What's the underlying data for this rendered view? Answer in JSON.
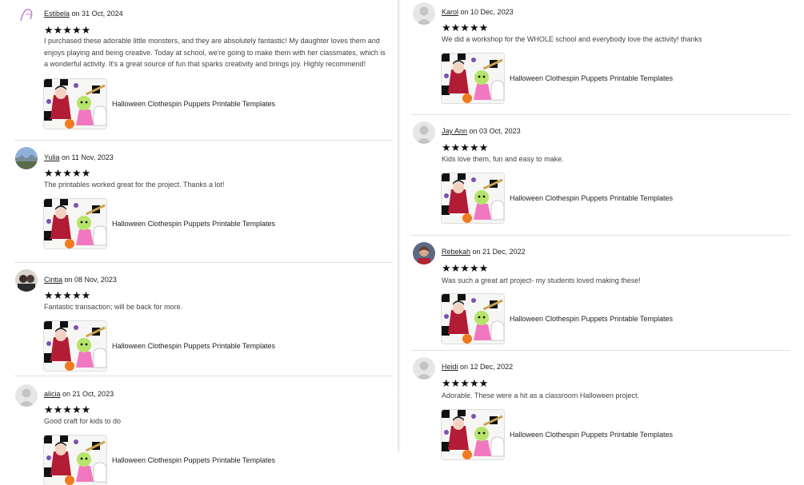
{
  "reviews_left": [
    {
      "name": "Estibela",
      "date_text": "on 31 Oct, 2024",
      "stars": "★★★★★",
      "text": "I purchased these adorable little monsters, and they are absolutely fantastic! My daughter loves them and enjoys playing and being creative. Today at school, we're going to make them with her classmates, which is a wonderful activity. It's a great source of fun that sparks creativity and brings joy. Highly recommend!",
      "item_title": "Halloween Clothespin Puppets Printable Templates"
    },
    {
      "name": "Yulia",
      "date_text": "on 11 Nov, 2023",
      "stars": "★★★★★",
      "text": "The printables worked great for the project. Thanks a lot!",
      "item_title": "Halloween Clothespin Puppets Printable Templates"
    },
    {
      "name": "Cintia",
      "date_text": "on 08 Nov, 2023",
      "stars": "★★★★★",
      "text": "Fantastic transaction; will be back for more.",
      "item_title": "Halloween Clothespin Puppets Printable Templates"
    },
    {
      "name": "alicia",
      "date_text": "on 21 Oct, 2023",
      "stars": "★★★★★",
      "text": "Good craft for kids to do",
      "item_title": "Halloween Clothespin Puppets Printable Templates"
    }
  ],
  "reviews_right": [
    {
      "name": "Karol",
      "date_text": "on 10 Dec, 2023",
      "stars": "★★★★★",
      "text": "We did a workshop for the WHOLE school and everybody love the activity! thanks",
      "item_title": "Halloween Clothespin Puppets Printable Templates"
    },
    {
      "name": "Jay Ann",
      "date_text": "on 03 Oct, 2023",
      "stars": "★★★★★",
      "text": "Kids love them, fun and easy to make.",
      "item_title": "Halloween Clothespin Puppets Printable Templates"
    },
    {
      "name": "Rebekah",
      "date_text": "on 21 Dec, 2022",
      "stars": "★★★★★",
      "text": "Was such a great art project- my students loved making these!",
      "item_title": "Halloween Clothespin Puppets Printable Templates"
    },
    {
      "name": "Heidi",
      "date_text": "on 12 Dec, 2022",
      "stars": "★★★★★",
      "text": "Adorable. These were a hit as a classroom Halloween project.",
      "item_title": "Halloween Clothespin Puppets Printable Templates"
    }
  ],
  "avatars": {
    "Estibela": "illustrated-drawing-avatar",
    "Yulia": "landscape-photo-avatar",
    "Cintia": "two-people-photo-avatar",
    "alicia": "default-person-avatar",
    "Karol": "default-person-avatar",
    "Jay Ann": "default-person-avatar",
    "Rebekah": "person-photo-avatar",
    "Heidi": "default-person-avatar"
  },
  "colors": {
    "divider": "#e1e1e1",
    "star": "#111111",
    "text": "#444444"
  }
}
